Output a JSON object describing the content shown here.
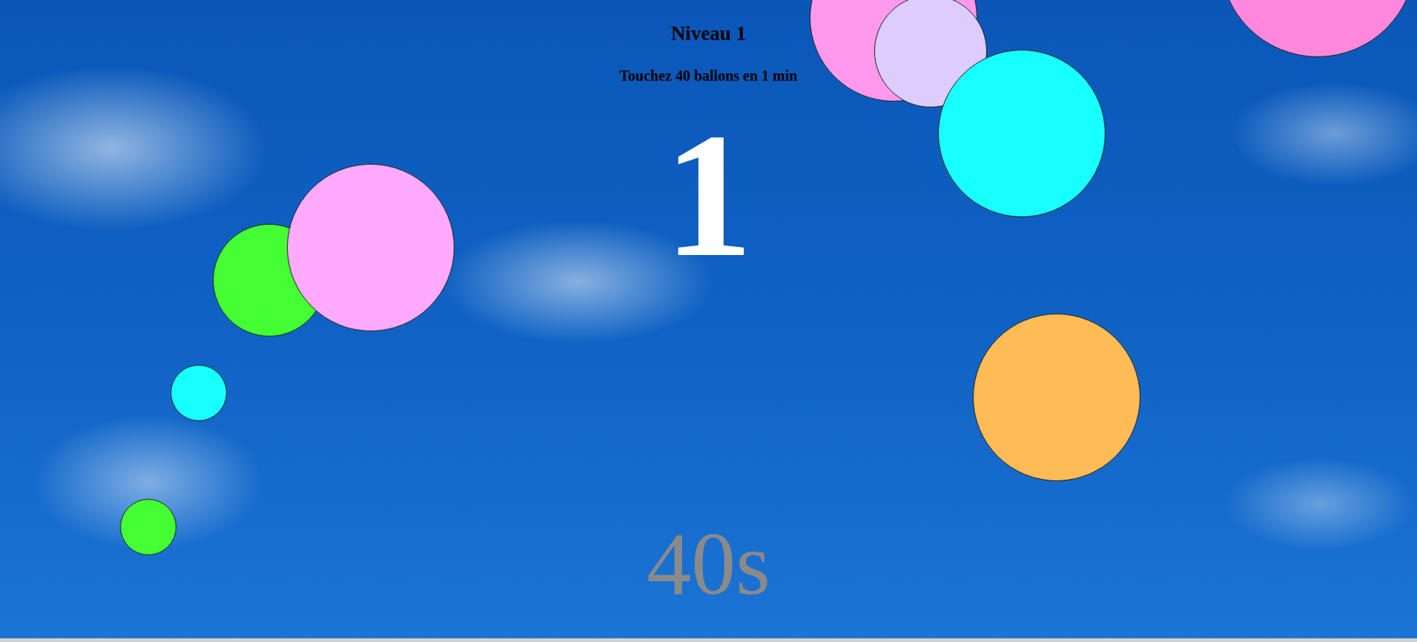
{
  "level": {
    "title": "Niveau 1",
    "goal": "Touchez 40 ballons en 1 min"
  },
  "countdown": "1",
  "timer": "40s",
  "balloons": [
    {
      "color": "#ff99ee"
    },
    {
      "color": "#dcccff"
    },
    {
      "color": "#18ffff"
    },
    {
      "color": "#ff88dd"
    },
    {
      "color": "#44ff33"
    },
    {
      "color": "#ffaaff"
    },
    {
      "color": "#18ffff"
    },
    {
      "color": "#44ff33"
    },
    {
      "color": "#ffbb55"
    }
  ]
}
